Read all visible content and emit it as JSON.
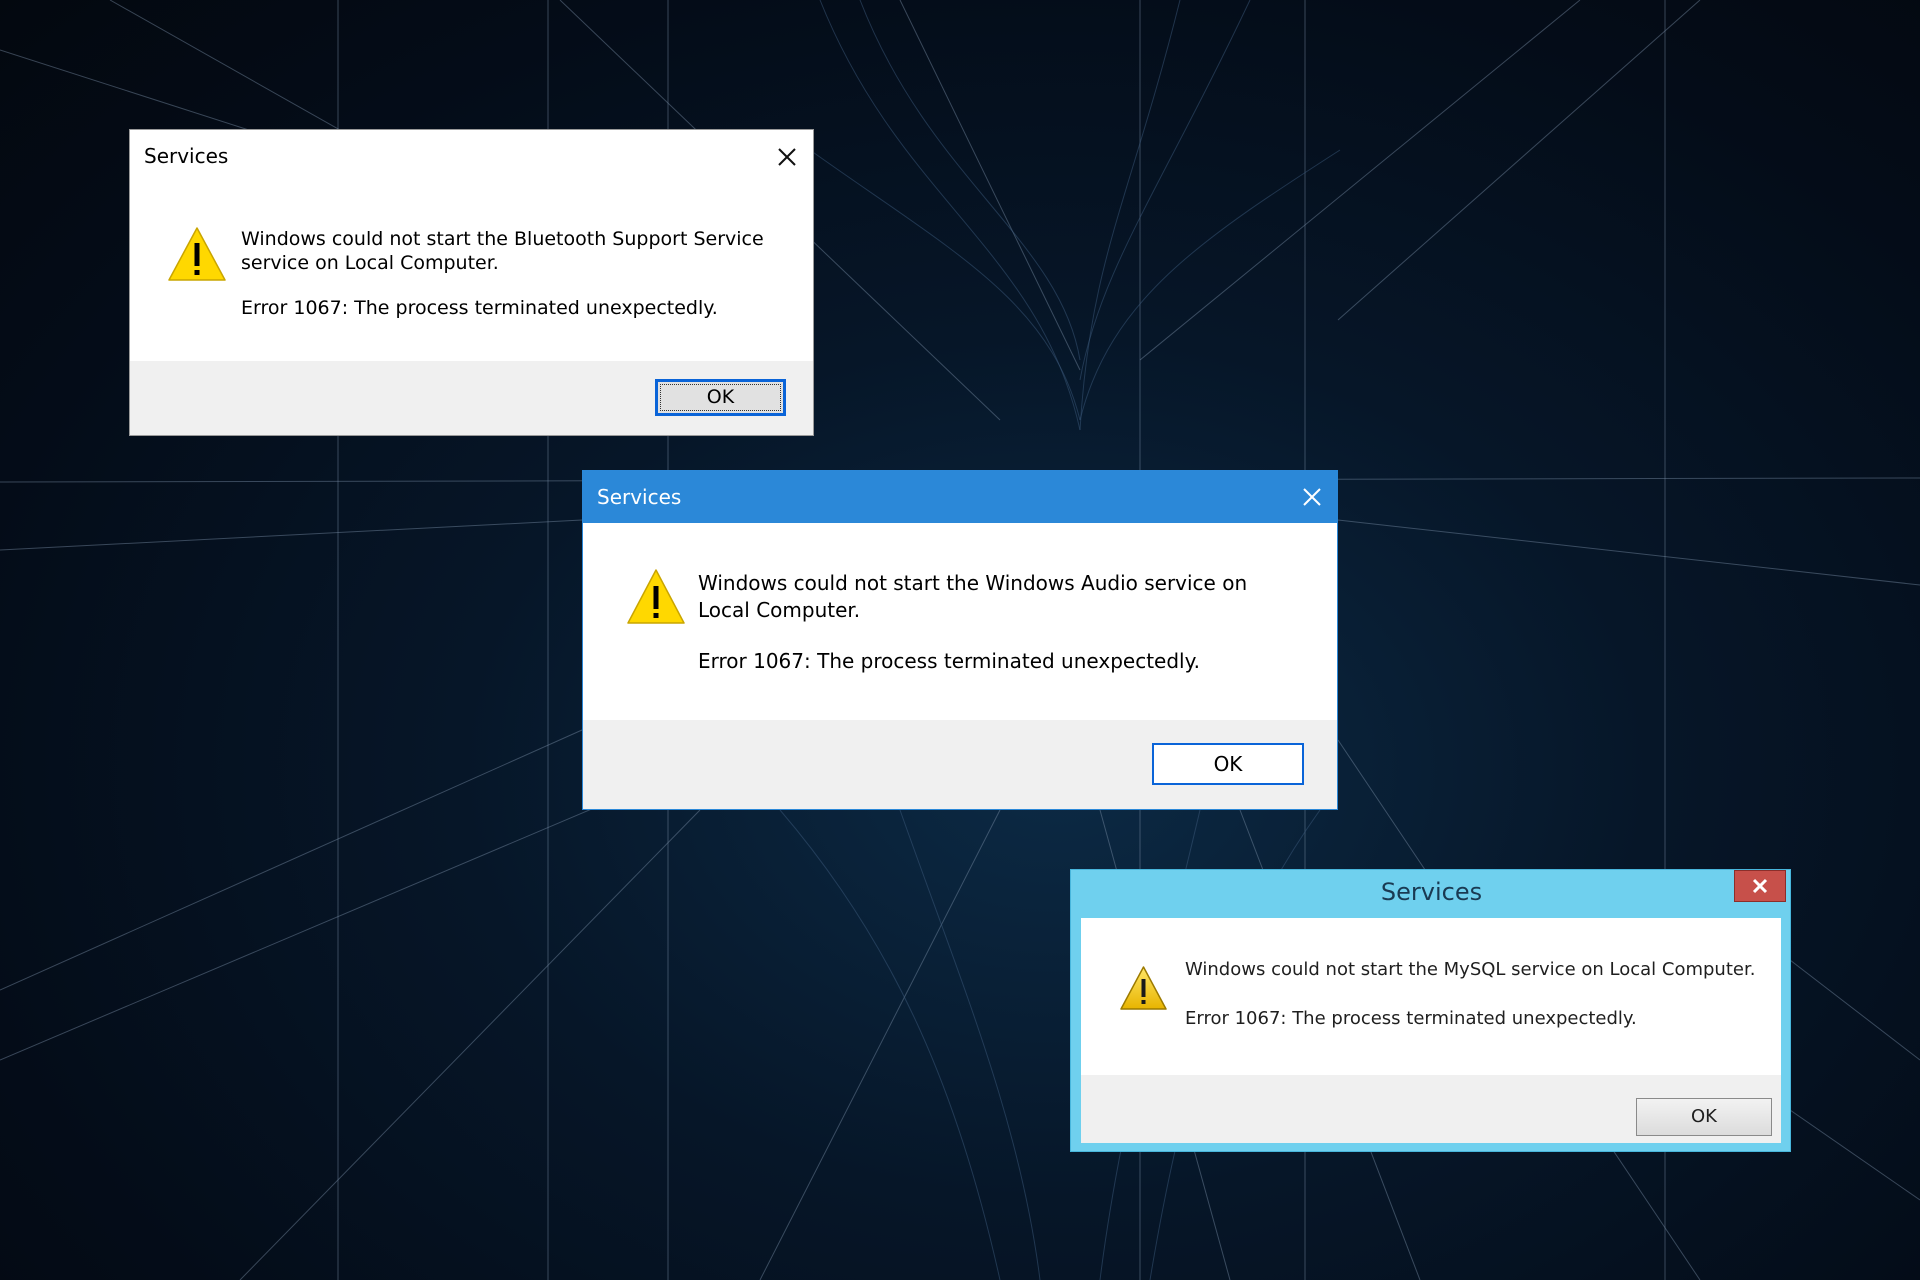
{
  "dialogs": [
    {
      "title": "Services",
      "message": "Windows could not start the Bluetooth Support Service service on Local Computer.",
      "error": "Error 1067: The process terminated unexpectedly.",
      "ok_label": "OK"
    },
    {
      "title": "Services",
      "message": "Windows could not start the Windows Audio service on Local Computer.",
      "error": "Error 1067: The process terminated unexpectedly.",
      "ok_label": "OK",
      "accent": "#2b88d8"
    },
    {
      "title": "Services",
      "message": "Windows could not start the MySQL service on Local Computer.",
      "error": "Error 1067: The process terminated unexpectedly.",
      "ok_label": "OK",
      "accent": "#6fd0ee"
    }
  ],
  "icons": {
    "warning": "warning-icon",
    "close": "close-icon"
  },
  "colors": {
    "background": "#061628",
    "warning_yellow": "#ffd800",
    "close_red": "#c7504a"
  }
}
